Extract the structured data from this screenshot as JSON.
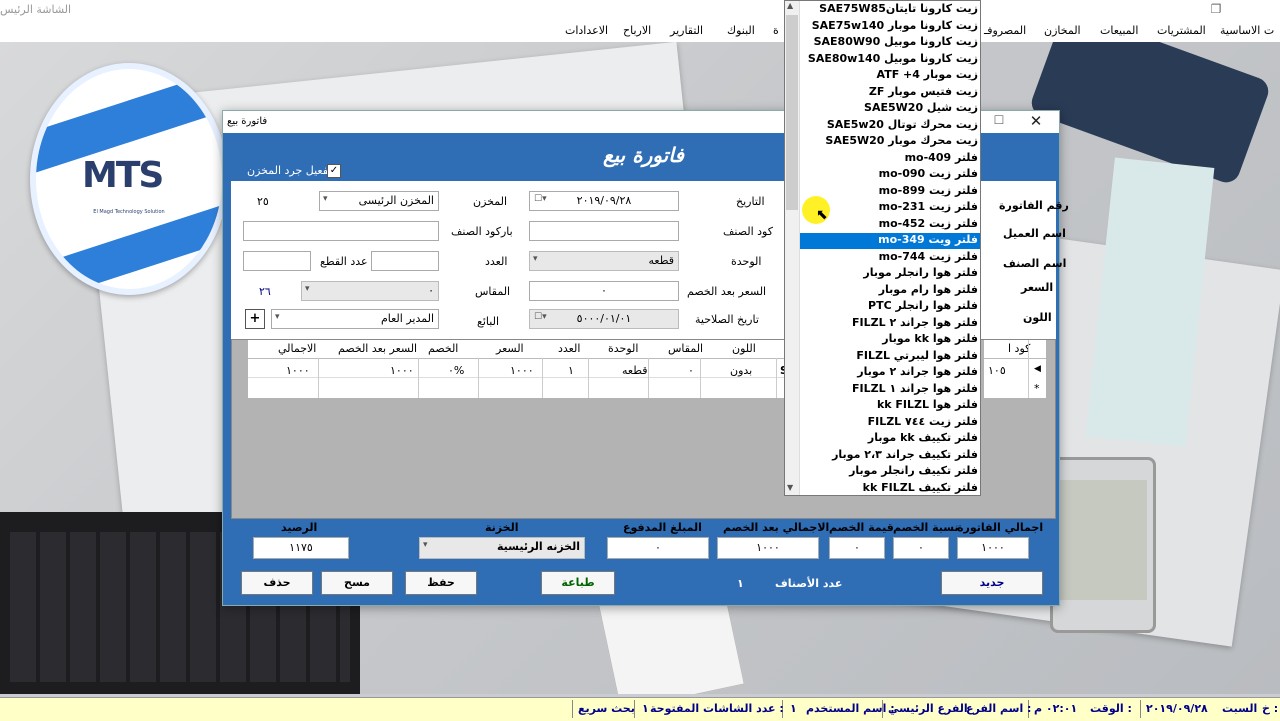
{
  "main_window": {
    "title": "الشاشة الرئيس",
    "restore_glyph": "❐"
  },
  "menu": [
    "ت الاساسية",
    "المشتريات",
    "المبيعات",
    "المخازن",
    "المصروفـ",
    "ة",
    "البنوك",
    "التقارير",
    "الارباح",
    "الاعدادات"
  ],
  "logo": {
    "letters": "MTS",
    "tagline": "El Magd Technology Solution"
  },
  "dialog": {
    "title": "فاتورة بيع",
    "heading": "فاتورة بيع",
    "close_glyph": "✕",
    "max_glyph": "☐",
    "checkbox_label": "تفعيل جرد المخزن",
    "labels": {
      "invoice_no": "رقم الفاتورة",
      "customer": "اسم العميل",
      "item_name": "اسم الصنف",
      "price": "السعر",
      "color": "اللون",
      "date": "التاريخ",
      "item_code": "كود الصنف",
      "unit": "الوحدة",
      "price_after_discount": "السعر بعد الخصم",
      "expiry": "تاريخ الصلاحية",
      "store": "المخزن",
      "barcode": "باركود الصنف",
      "count": "العدد",
      "size": "المقاس",
      "seller": "البائع",
      "pieces_count": "عدد القطع"
    },
    "values": {
      "date": "٢٠١٩/٠٩/٢٨",
      "unit": "قطعه",
      "price_after_discount": "٠",
      "expiry": "٥٠٠٠/٠١/٠١",
      "store": "المخزن الرئيسى",
      "store_qty": "٢٥",
      "size": "٠",
      "size_qty": "٢٦",
      "seller": "المدير العام",
      "add_glyph": "+"
    },
    "grid": {
      "headers": [
        "الاجمالي",
        "السعر بعد الخصم",
        "الخصم",
        "السعر",
        "العدد",
        "الوحدة",
        "المقاس",
        "اللون"
      ],
      "row": [
        "١٠٠٠",
        "١٠٠٠",
        "٠%",
        "١٠٠٠",
        "١",
        "قطعه",
        "٠",
        "بدون",
        "SA"
      ],
      "right_header": "كود ا",
      "right_value": "١٠٥",
      "row_marker": "◀",
      "new_marker": "*"
    },
    "totals": {
      "balance_label": "الرصيد",
      "balance": "١١٧٥",
      "treasury_label": "الخزنة",
      "treasury": "الخزنه الرئيسية",
      "paid_label": "المبلغ المدفوع",
      "paid": "٠",
      "total_after_label": "الاجمالي بعد الخصم",
      "total_after": "١٠٠٠",
      "discount_value_label": "قيمة الخصم",
      "discount_value": "٠",
      "discount_pct_label": "نسبة الخصم",
      "discount_pct": "٠",
      "invoice_total_label": "اجمالي الفاتورة",
      "invoice_total": "١٠٠٠"
    },
    "buttons": {
      "delete": "حذف",
      "clear": "مسح",
      "save": "حفظ",
      "print": "طباعة",
      "items_count_label": "عدد الأصناف",
      "items_count": "١",
      "new": "جديد"
    }
  },
  "dropdown": {
    "items": [
      "زيت كارونا تايتانSAE75W85",
      "زيت كارونا موبار SAE75w140",
      "زيت كارونا موبيل SAE80W90",
      "زيت كارونا موبيل SAE80w140",
      "زيت موبار ATF +4",
      "زيت فتيس موبار ZF",
      "زيت شيل SAE5W20",
      "زيت محرك توتال SAE5w20",
      "زيت محرك موبار SAE5W20",
      "فلتر mo-409",
      "فلتر زيت mo-090",
      "فلتر زيت mo-899",
      "فلتر زيت mo-231",
      "فلتر زيت mo-452",
      "فلتر ويت mo-349",
      "فلتر زيت mo-744",
      "فلتر هوا رانجلر موبار",
      "فلتر هوا رام موبار",
      "فلتر هوا رانجلر PTC",
      "فلتر هوا جراند ٢ FILZL",
      "فلتر هوا kk موبار",
      "فلتر هوا ليبرتي FILZL",
      "فلتر هوا جراند ٢ موبار",
      "فلتر هوا جراند ١ FILZL",
      "فلتر هوا kk FILZL",
      "فلتر زيت ٧٤٤ FILZL",
      "فلتر تكييف kk موبار",
      "فلتر تكييف جراند ٢،٣ موبار",
      "فلتر تكييف رانجلر موبار",
      "فلتر تكييف kk FILZL"
    ],
    "selected_index": 14,
    "up_glyph": "▲",
    "down_glyph": "▼"
  },
  "status": {
    "date_label": "خ :",
    "day": "السبت",
    "date": "٢٠١٩/٠٩/٢٨",
    "time_label": "الوقت :",
    "time": "٠٢:٠١ م",
    "branch_label": "اسم الفرع :",
    "branch": "الفرع الرئيسي",
    "user_label": "اسم المستخدم :",
    "user": "١",
    "screens_label": "عدد الشاشات المفتوحة :",
    "screens": "١",
    "quick_search": "بحث سريع"
  },
  "colors": {
    "accent": "#2f6db5",
    "selection": "#0078d7",
    "status_bg": "#ffffc8"
  }
}
